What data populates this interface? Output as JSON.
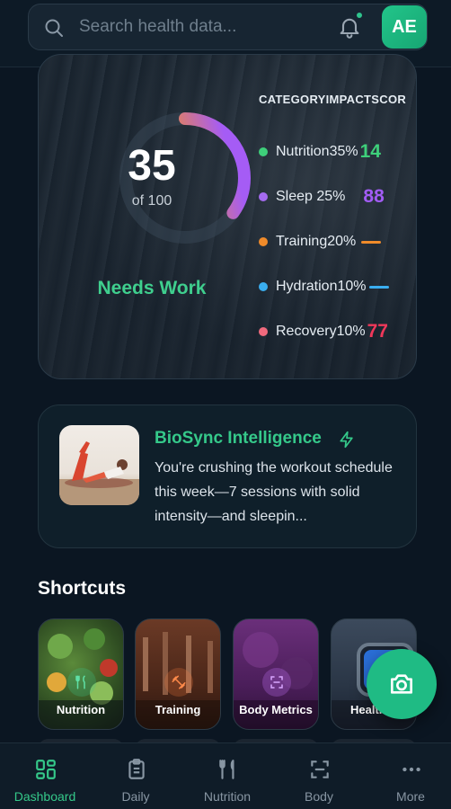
{
  "search": {
    "placeholder": "Search health data..."
  },
  "user": {
    "initials": "AE"
  },
  "score": {
    "value": "35",
    "max_label": "of 100",
    "fraction": 0.35,
    "status": "Needs Work",
    "status_color": "#3fcf8e"
  },
  "categories": {
    "headers": [
      "CATEGORY",
      "IMPACT",
      "SCOR"
    ],
    "rows": [
      {
        "name": "Nutrition",
        "impact": "35%",
        "score": "14",
        "color": "#3ecf7a",
        "score_color": "#3ecf7a"
      },
      {
        "name": "Sleep",
        "impact": "25%",
        "score": "88",
        "color": "#a56bf0",
        "score_color": "#a25cf5"
      },
      {
        "name": "Training",
        "impact": "20%",
        "score": "",
        "color": "#f08b2a",
        "score_color": "#f08b2a"
      },
      {
        "name": "Hydration",
        "impact": "10%",
        "score": "",
        "color": "#3aaef0",
        "score_color": "#3aaef0"
      },
      {
        "name": "Recovery",
        "impact": "10%",
        "score": "77",
        "color": "#f06a7d",
        "score_color": "#f0385a"
      }
    ]
  },
  "insight": {
    "title": "BioSync Intelligence",
    "text": "You're crushing the workout schedule this week—7 sessions with solid intensity—and sleepin..."
  },
  "shortcuts": {
    "title": "Shortcuts",
    "items": [
      {
        "label": "Nutrition",
        "icon": "utensils-icon"
      },
      {
        "label": "Training",
        "icon": "dumbbell-icon"
      },
      {
        "label": "Body Metrics",
        "icon": "scan-icon"
      },
      {
        "label": "Health S",
        "icon": "watch-icon"
      }
    ]
  },
  "nav": {
    "items": [
      {
        "label": "Dashboard",
        "icon": "dashboard-icon",
        "active": true
      },
      {
        "label": "Daily",
        "icon": "clipboard-icon",
        "active": false
      },
      {
        "label": "Nutrition",
        "icon": "utensils-icon",
        "active": false
      },
      {
        "label": "Body",
        "icon": "scan-icon",
        "active": false
      },
      {
        "label": "More",
        "icon": "more-icon",
        "active": false
      }
    ]
  },
  "colors": {
    "accent": "#35c98a",
    "background": "#0b1622"
  }
}
